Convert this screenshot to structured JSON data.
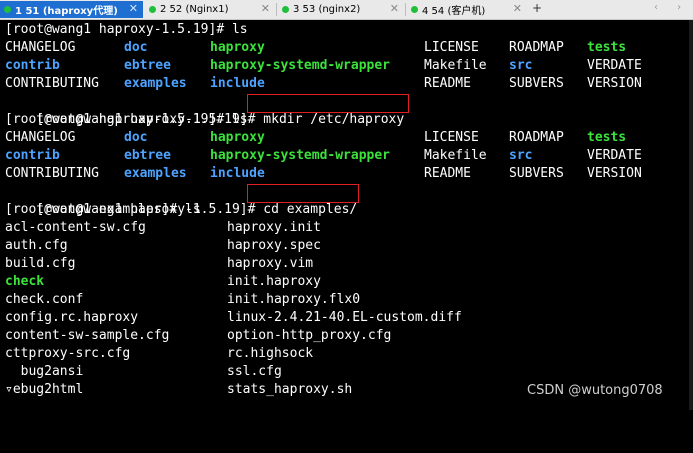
{
  "tabs": [
    {
      "label": "1 51  (haproxy代理)",
      "active": true
    },
    {
      "label": "2 52  (Nginx1)",
      "active": false
    },
    {
      "label": "3 53  (nginx2)",
      "active": false
    },
    {
      "label": "4 54  (客户机)",
      "active": false
    }
  ],
  "tab_add": "+",
  "nav_arrows": "‹ ›",
  "terminal": {
    "prompt1": "[root@wang1 haproxy-1.5.19]# ls",
    "ls1": {
      "r1": [
        "CHANGELOG",
        "doc",
        "haproxy",
        "LICENSE",
        "ROADMAP",
        "tests"
      ],
      "r2": [
        "contrib",
        "ebtree",
        "haproxy-systemd-wrapper",
        "Makefile",
        "src",
        "VERDATE"
      ],
      "r3": [
        "CONTRIBUTING",
        "examples",
        "include",
        "README",
        "SUBVERS",
        "VERSION"
      ]
    },
    "prompt2": "[root@wang1 haproxy-1.5.19]# ",
    "cmd2": "mkdir /etc/haproxy",
    "prompt3": "[root@wang1 haproxy-1.5.19]# ls",
    "ls2": {
      "r1": [
        "CHANGELOG",
        "doc",
        "haproxy",
        "LICENSE",
        "ROADMAP",
        "tests"
      ],
      "r2": [
        "contrib",
        "ebtree",
        "haproxy-systemd-wrapper",
        "Makefile",
        "src",
        "VERDATE"
      ],
      "r3": [
        "CONTRIBUTING",
        "examples",
        "include",
        "README",
        "SUBVERS",
        "VERSION"
      ]
    },
    "prompt4": "[root@wang1 haproxy-1.5.19]# ",
    "cmd4": "cd examples/",
    "prompt5": "[root@wang1 examples]# ls",
    "files": [
      [
        "acl-content-sw.cfg",
        "haproxy.init"
      ],
      [
        "auth.cfg",
        "haproxy.spec"
      ],
      [
        "build.cfg",
        "haproxy.vim"
      ],
      [
        "check",
        "init.haproxy"
      ],
      [
        "check.conf",
        "init.haproxy.flx0"
      ],
      [
        "config.rc.haproxy",
        "linux-2.4.21-40.EL-custom.diff"
      ],
      [
        "content-sw-sample.cfg",
        "option-http_proxy.cfg"
      ],
      [
        "cttproxy-src.cfg",
        "rc.highsock"
      ],
      [
        "  bug2ansi",
        "ssl.cfg"
      ],
      [
        "▿ebug2html",
        "stats_haproxy.sh"
      ]
    ]
  },
  "watermark": "CSDN @wutong0708",
  "colors": {
    "dir": "#4da3ff",
    "exec": "#3ce23c",
    "highlight": "#e02020",
    "active_tab": "#1e6fd1"
  }
}
